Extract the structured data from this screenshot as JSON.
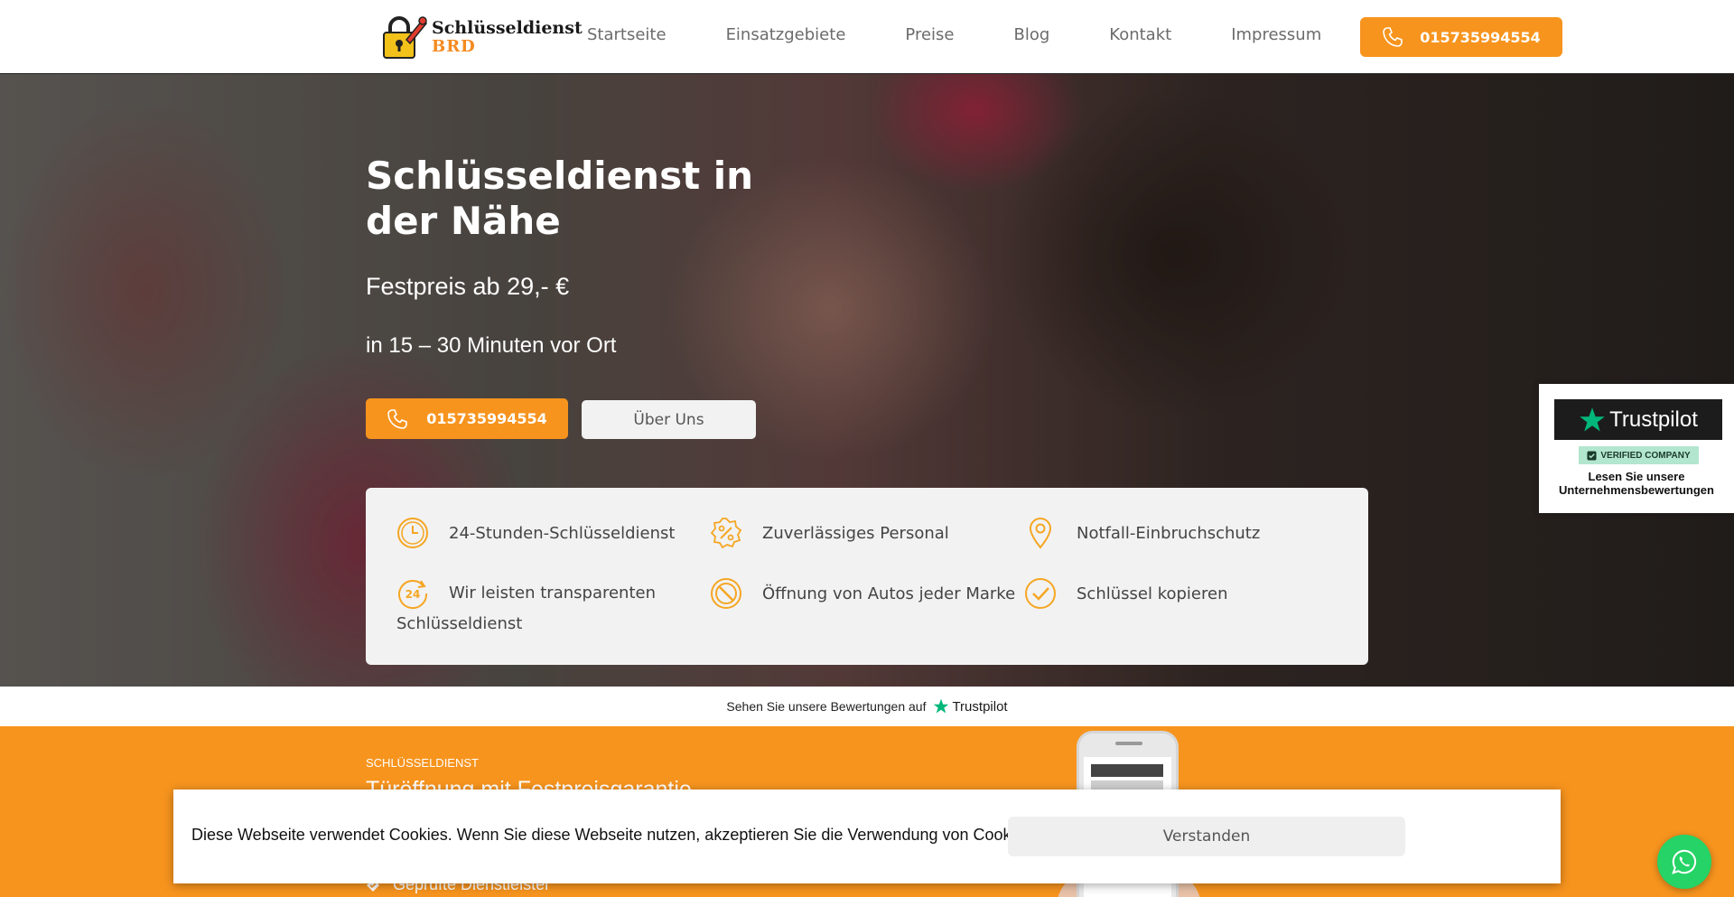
{
  "header": {
    "logo_line1": "Schlüsseldienst",
    "logo_line2": "BRD",
    "nav": [
      "Startseite",
      "Einsatzgebiete",
      "Preise",
      "Blog",
      "Kontakt",
      "Impressum"
    ],
    "phone": "015735994554"
  },
  "hero": {
    "title": "Schlüsseldienst in der Nähe",
    "price": "Festpreis ab 29,- €",
    "time": "in 15 – 30 Minuten vor Ort",
    "phone_button": "015735994554",
    "about_button": "Über Uns"
  },
  "features": [
    {
      "label": "24-Stunden-Schlüsseldienst",
      "icon": "clock-icon"
    },
    {
      "label": "Zuverlässiges Personal",
      "icon": "percent-badge-icon"
    },
    {
      "label": "Notfall-Einbruchschutz",
      "icon": "map-pin-icon"
    },
    {
      "label": "Wir leisten transparenten Schlüsseldienst",
      "icon": "24-hours-icon"
    },
    {
      "label": "Öffnung von Autos jeder Marke",
      "icon": "prohibited-icon"
    },
    {
      "label": "Schlüssel kopieren",
      "icon": "check-circle-icon"
    }
  ],
  "trustpilot_badge": {
    "brand": "Trustpilot",
    "verified": "VERIFIED COMPANY",
    "read_line1": "Lesen Sie unsere",
    "read_line2": "Unternehmensbewertungen"
  },
  "trustpilot_strip": {
    "text": "Sehen Sie unsere Bewertungen auf",
    "brand": "Trustpilot"
  },
  "orange_section": {
    "label": "SCHLÜSSELDIENST",
    "title": "Türöffnung mit Festpreisgarantie",
    "check_item": "Geprüfte Dienstleister"
  },
  "cookie": {
    "text": "Diese Webseite verwendet Cookies. Wenn Sie diese Webseite nutzen, akzeptieren Sie die Verwendung von Cookies.",
    "button": "Verstanden"
  },
  "colors": {
    "accent": "#f7941e",
    "feature_icon": "#f5a623",
    "trustpilot_green": "#00b67a",
    "whatsapp": "#25d366"
  }
}
